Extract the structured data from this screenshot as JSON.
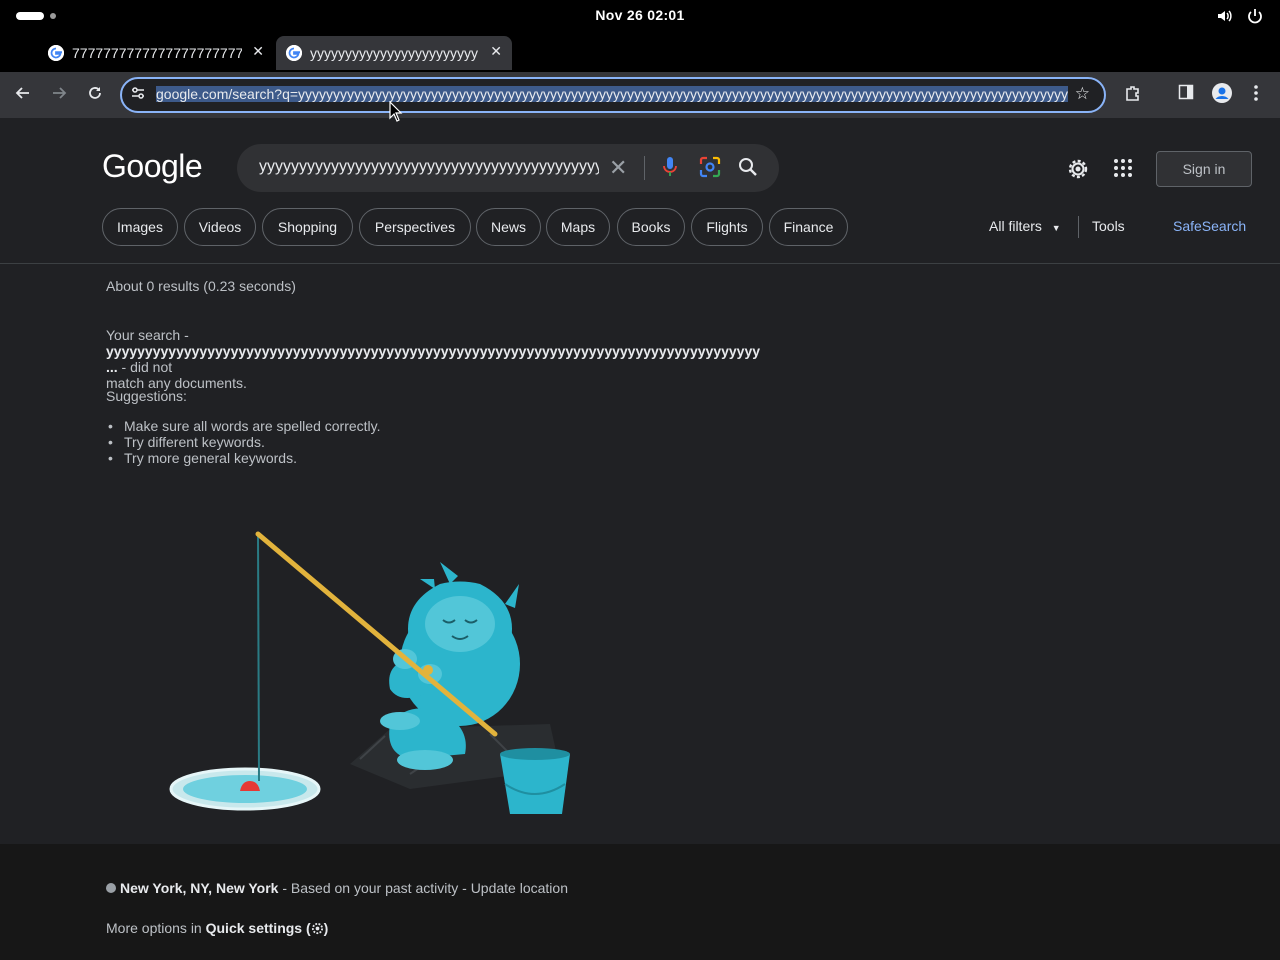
{
  "system": {
    "clock": "Nov 26  02:01",
    "volume_icon": "volume-icon",
    "power_icon": "power-icon"
  },
  "tabs": [
    {
      "title": "7777777777777777777777",
      "active": false
    },
    {
      "title": "yyyyyyyyyyyyyyyyyyyyyyyy",
      "active": true
    }
  ],
  "toolbar": {
    "url": "google.com/search?q=yyyyyyyyyyyyyyyyyyyyyyyyyyyyyyyyyyyyyyyyyyyyyyyyyyyyyyyyyyyyyyyyyyyyyyyyyyyyyyyyyyyyyyyyyyyyyyyyyyyyyyyyyyyyyyyyyyy"
  },
  "header": {
    "logo": "Google",
    "query": "yyyyyyyyyyyyyyyyyyyyyyyyyyyyyyyyyyyyyyyyyyyyyyyyyyyyyy",
    "sign_in": "Sign in",
    "chips": [
      "Images",
      "Videos",
      "Shopping",
      "Perspectives",
      "News",
      "Maps",
      "Books",
      "Flights",
      "Finance"
    ],
    "all_filters": "All filters",
    "tools": "Tools",
    "safesearch": "SafeSearch"
  },
  "results": {
    "stats": "About 0 results (0.23 seconds)",
    "your_search": "Your search -",
    "query_truncated": "yyyyyyyyyyyyyyyyyyyyyyyyyyyyyyyyyyyyyyyyyyyyyyyyyyyyyyyyyyyyyyyyyyyyyyyyyyyyyyyyyyyy ...",
    "did_not": " - did not",
    "match": "match any documents.",
    "suggestions_label": "Suggestions:",
    "suggestions": [
      "Make sure all words are spelled correctly.",
      "Try different keywords.",
      "Try more general keywords."
    ]
  },
  "footer": {
    "location": "New York, NY, New York",
    "based_on": " - Based on your past activity - ",
    "update_location": "Update location",
    "more_options": "More options in ",
    "quick_settings": "Quick settings ("
  },
  "colors": {
    "background": "#202124",
    "accent": "#8ab4f8",
    "illustration": "#2cb5cc"
  }
}
